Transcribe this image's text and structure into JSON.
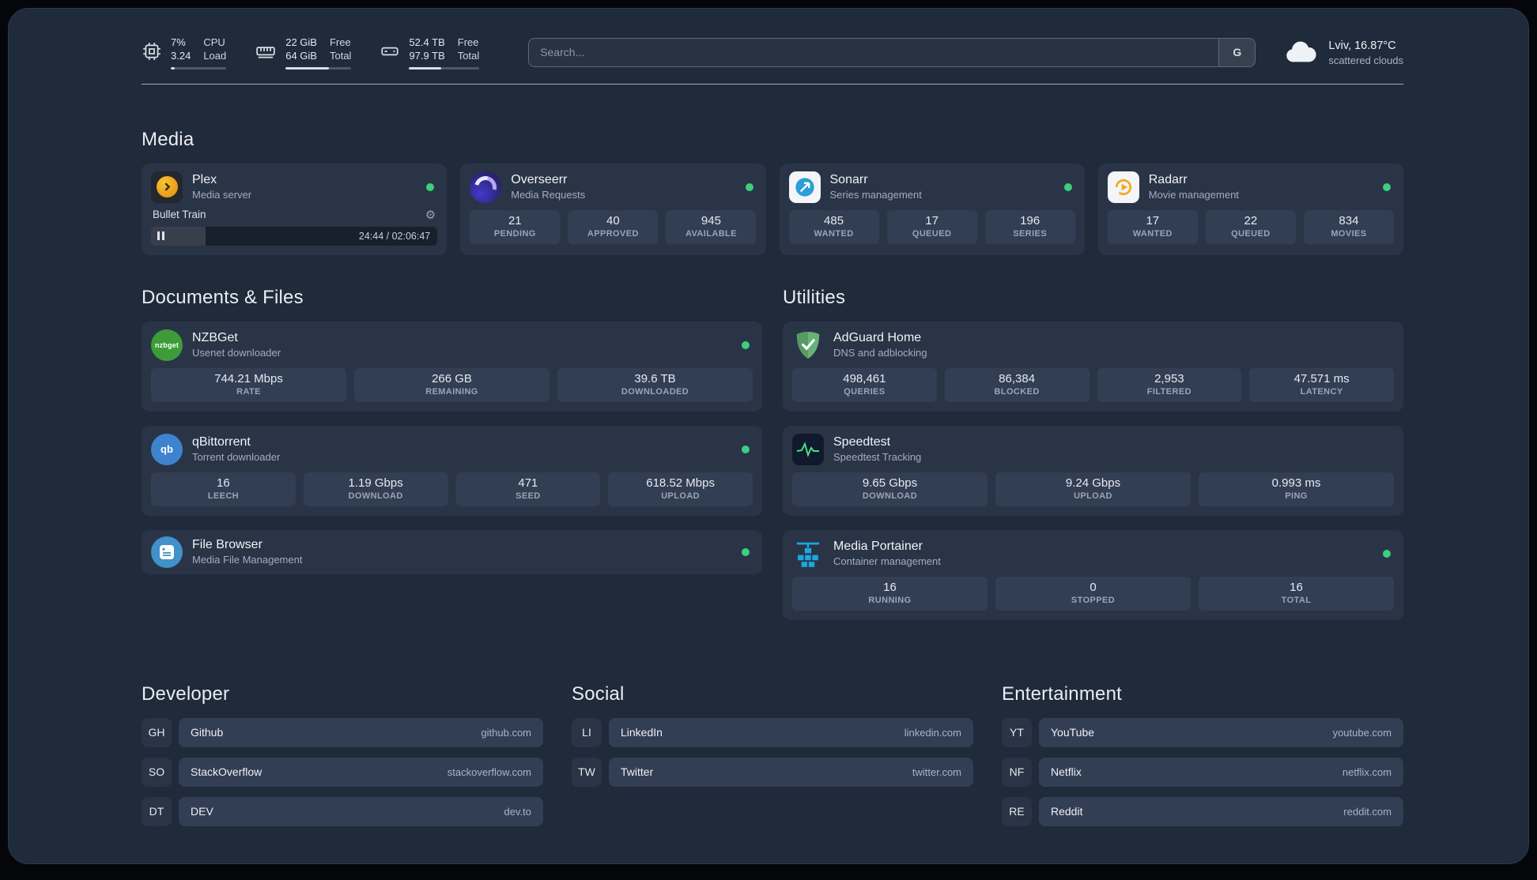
{
  "topbar": {
    "cpu": {
      "percent": "7%",
      "load": "3.24",
      "label_top": "CPU",
      "label_bottom": "Load",
      "bar_pct": 7
    },
    "memory": {
      "free": "22 GiB",
      "total": "64 GiB",
      "label_top": "Free",
      "label_bottom": "Total",
      "bar_pct": 66
    },
    "disk": {
      "free": "52.4 TB",
      "total": "97.9 TB",
      "label_top": "Free",
      "label_bottom": "Total",
      "bar_pct": 46
    },
    "search": {
      "placeholder": "Search...",
      "provider": "G"
    },
    "weather": {
      "location": "Lviv, 16.87°C",
      "condition": "scattered clouds"
    }
  },
  "sections": {
    "media": {
      "title": "Media",
      "services": [
        {
          "name": "Plex",
          "subtitle": "Media server",
          "status": "online",
          "player": {
            "title": "Bullet Train",
            "time": "24:44 / 02:06:47",
            "progress_pct": 19
          }
        },
        {
          "name": "Overseerr",
          "subtitle": "Media Requests",
          "status": "online",
          "stats": [
            {
              "value": "21",
              "label": "PENDING"
            },
            {
              "value": "40",
              "label": "APPROVED"
            },
            {
              "value": "945",
              "label": "AVAILABLE"
            }
          ]
        },
        {
          "name": "Sonarr",
          "subtitle": "Series management",
          "status": "online",
          "stats": [
            {
              "value": "485",
              "label": "WANTED"
            },
            {
              "value": "17",
              "label": "QUEUED"
            },
            {
              "value": "196",
              "label": "SERIES"
            }
          ]
        },
        {
          "name": "Radarr",
          "subtitle": "Movie management",
          "status": "online",
          "stats": [
            {
              "value": "17",
              "label": "WANTED"
            },
            {
              "value": "22",
              "label": "QUEUED"
            },
            {
              "value": "834",
              "label": "MOVIES"
            }
          ]
        }
      ]
    },
    "documents": {
      "title": "Documents & Files",
      "services": [
        {
          "name": "NZBGet",
          "subtitle": "Usenet downloader",
          "status": "online",
          "stats": [
            {
              "value": "744.21 Mbps",
              "label": "RATE"
            },
            {
              "value": "266 GB",
              "label": "REMAINING"
            },
            {
              "value": "39.6 TB",
              "label": "DOWNLOADED"
            }
          ]
        },
        {
          "name": "qBittorrent",
          "subtitle": "Torrent downloader",
          "status": "online",
          "stats": [
            {
              "value": "16",
              "label": "LEECH"
            },
            {
              "value": "1.19 Gbps",
              "label": "DOWNLOAD"
            },
            {
              "value": "471",
              "label": "SEED"
            },
            {
              "value": "618.52 Mbps",
              "label": "UPLOAD"
            }
          ]
        },
        {
          "name": "File Browser",
          "subtitle": "Media File Management",
          "status": "online"
        }
      ]
    },
    "utilities": {
      "title": "Utilities",
      "services": [
        {
          "name": "AdGuard Home",
          "subtitle": "DNS and adblocking",
          "stats": [
            {
              "value": "498,461",
              "label": "QUERIES"
            },
            {
              "value": "86,384",
              "label": "BLOCKED"
            },
            {
              "value": "2,953",
              "label": "FILTERED"
            },
            {
              "value": "47.571 ms",
              "label": "LATENCY"
            }
          ]
        },
        {
          "name": "Speedtest",
          "subtitle": "Speedtest Tracking",
          "stats": [
            {
              "value": "9.65 Gbps",
              "label": "DOWNLOAD"
            },
            {
              "value": "9.24 Gbps",
              "label": "UPLOAD"
            },
            {
              "value": "0.993 ms",
              "label": "PING"
            }
          ]
        },
        {
          "name": "Media Portainer",
          "subtitle": "Container management",
          "status": "online",
          "stats": [
            {
              "value": "16",
              "label": "RUNNING"
            },
            {
              "value": "0",
              "label": "STOPPED"
            },
            {
              "value": "16",
              "label": "TOTAL"
            }
          ]
        }
      ]
    }
  },
  "bookmarks": [
    {
      "title": "Developer",
      "items": [
        {
          "abbr": "GH",
          "name": "Github",
          "domain": "github.com"
        },
        {
          "abbr": "SO",
          "name": "StackOverflow",
          "domain": "stackoverflow.com"
        },
        {
          "abbr": "DT",
          "name": "DEV",
          "domain": "dev.to"
        }
      ]
    },
    {
      "title": "Social",
      "items": [
        {
          "abbr": "LI",
          "name": "LinkedIn",
          "domain": "linkedin.com"
        },
        {
          "abbr": "TW",
          "name": "Twitter",
          "domain": "twitter.com"
        }
      ]
    },
    {
      "title": "Entertainment",
      "items": [
        {
          "abbr": "YT",
          "name": "YouTube",
          "domain": "youtube.com"
        },
        {
          "abbr": "NF",
          "name": "Netflix",
          "domain": "netflix.com"
        },
        {
          "abbr": "RE",
          "name": "Reddit",
          "domain": "reddit.com"
        }
      ]
    }
  ],
  "icons": {
    "gear": "⚙",
    "nzbget_text": "nzbget",
    "qbittorrent_text": "qb"
  },
  "colors": {
    "background": "#1f2a3b",
    "card": "#293447",
    "tile": "#323e54",
    "status_online": "#3bcf7e",
    "plex": "#eb9f13",
    "sonarr": "#2b9fd8",
    "radarr": "#f7a823",
    "nzbget": "#3d9c38",
    "qbittorrent": "#3f83cf",
    "adguard": "#67b279",
    "speedtest": "#49de80",
    "portainer": "#1ba8e0",
    "filebrowser": "#4191ca"
  }
}
